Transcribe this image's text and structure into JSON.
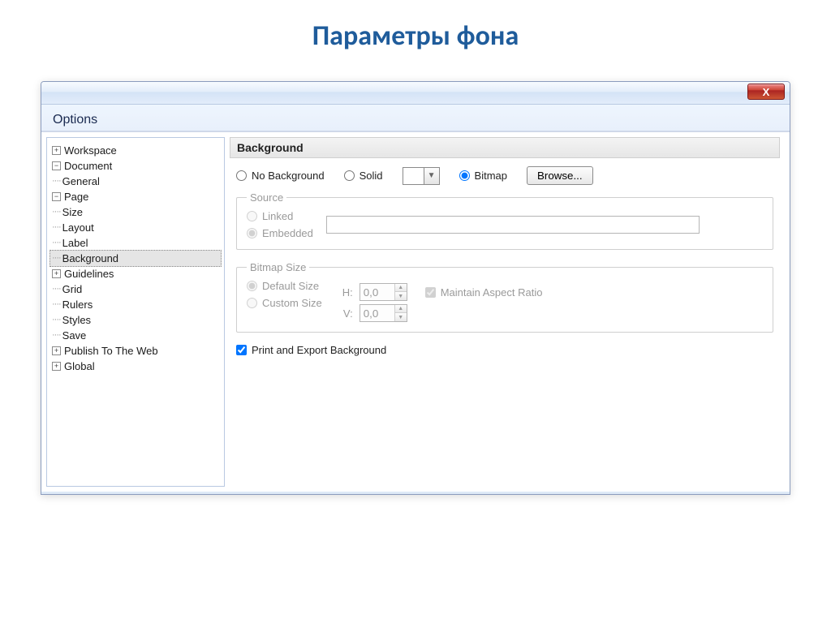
{
  "slide_title": "Параметры фона",
  "window": {
    "caption": "Options",
    "close_glyph": "X"
  },
  "tree": {
    "workspace": "Workspace",
    "document": "Document",
    "general": "General",
    "page": "Page",
    "size": "Size",
    "layout": "Layout",
    "label": "Label",
    "background": "Background",
    "guidelines": "Guidelines",
    "grid": "Grid",
    "rulers": "Rulers",
    "styles": "Styles",
    "save": "Save",
    "publish": "Publish To The Web",
    "global": "Global"
  },
  "panel": {
    "header": "Background",
    "no_background": "No Background",
    "solid": "Solid",
    "bitmap": "Bitmap",
    "browse": "Browse...",
    "source": {
      "legend": "Source",
      "linked": "Linked",
      "embedded": "Embedded"
    },
    "bitmap_size": {
      "legend": "Bitmap Size",
      "default": "Default Size",
      "custom": "Custom Size",
      "h_label": "H:",
      "v_label": "V:",
      "h_value": "0,0",
      "v_value": "0,0",
      "maintain": "Maintain Aspect Ratio"
    },
    "print_export": "Print and Export Background"
  }
}
